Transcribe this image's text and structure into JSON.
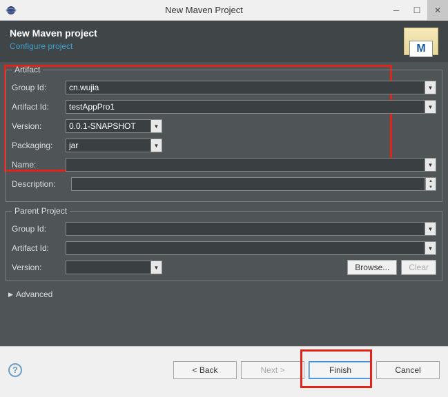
{
  "window": {
    "title": "New Maven Project"
  },
  "header": {
    "title": "New Maven project",
    "subtitle": "Configure project",
    "iconLetter": "M"
  },
  "artifact": {
    "legend": "Artifact",
    "groupIdLabel": "Group Id:",
    "groupId": "cn.wujia",
    "artifactIdLabel": "Artifact Id:",
    "artifactId": "testAppPro1",
    "versionLabel": "Version:",
    "version": "0.0.1-SNAPSHOT",
    "packagingLabel": "Packaging:",
    "packaging": "jar",
    "nameLabel": "Name:",
    "name": "",
    "descriptionLabel": "Description:",
    "description": ""
  },
  "parent": {
    "legend": "Parent Project",
    "groupIdLabel": "Group Id:",
    "groupId": "",
    "artifactIdLabel": "Artifact Id:",
    "artifactId": "",
    "versionLabel": "Version:",
    "version": "",
    "browse": "Browse...",
    "clear": "Clear"
  },
  "advanced": "Advanced",
  "footer": {
    "back": "< Back",
    "next": "Next >",
    "finish": "Finish",
    "cancel": "Cancel"
  }
}
